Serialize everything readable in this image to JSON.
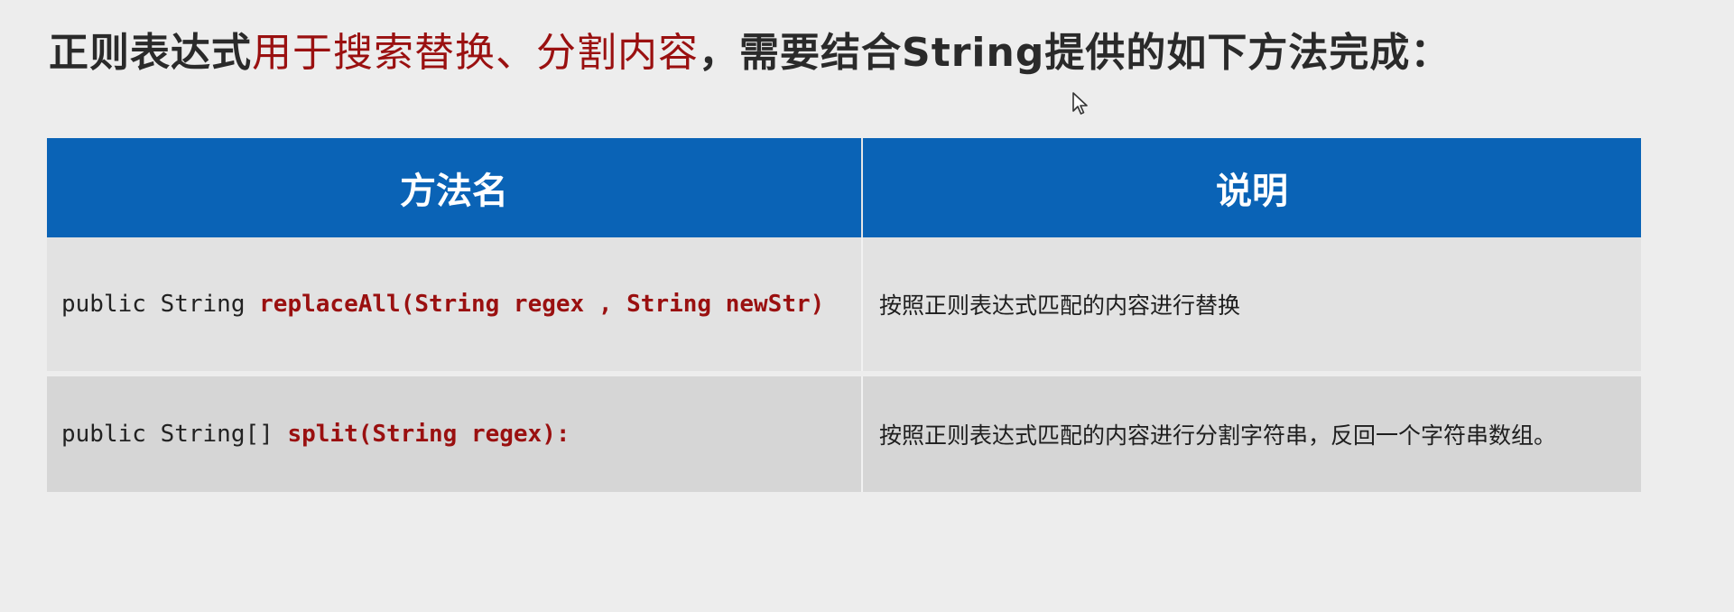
{
  "heading": {
    "part1": "正则表达式",
    "accent": "用于搜索替换、分割内容",
    "part2": "，需要结合String提供的如下方法完成："
  },
  "table": {
    "headers": [
      "方法名",
      "说明"
    ],
    "rows": [
      {
        "prefix": "public String ",
        "method": "replaceAll(String regex , String newStr)",
        "description": "按照正则表达式匹配的内容进行替换"
      },
      {
        "prefix": "public String[] ",
        "method": "split(String regex):",
        "description": "按照正则表达式匹配的内容进行分割字符串，反回一个字符串数组。"
      }
    ]
  },
  "colors": {
    "header_bg": "#0a63b6",
    "accent": "#9a1010"
  },
  "icons": {
    "cursor": "mouse-pointer-icon"
  }
}
